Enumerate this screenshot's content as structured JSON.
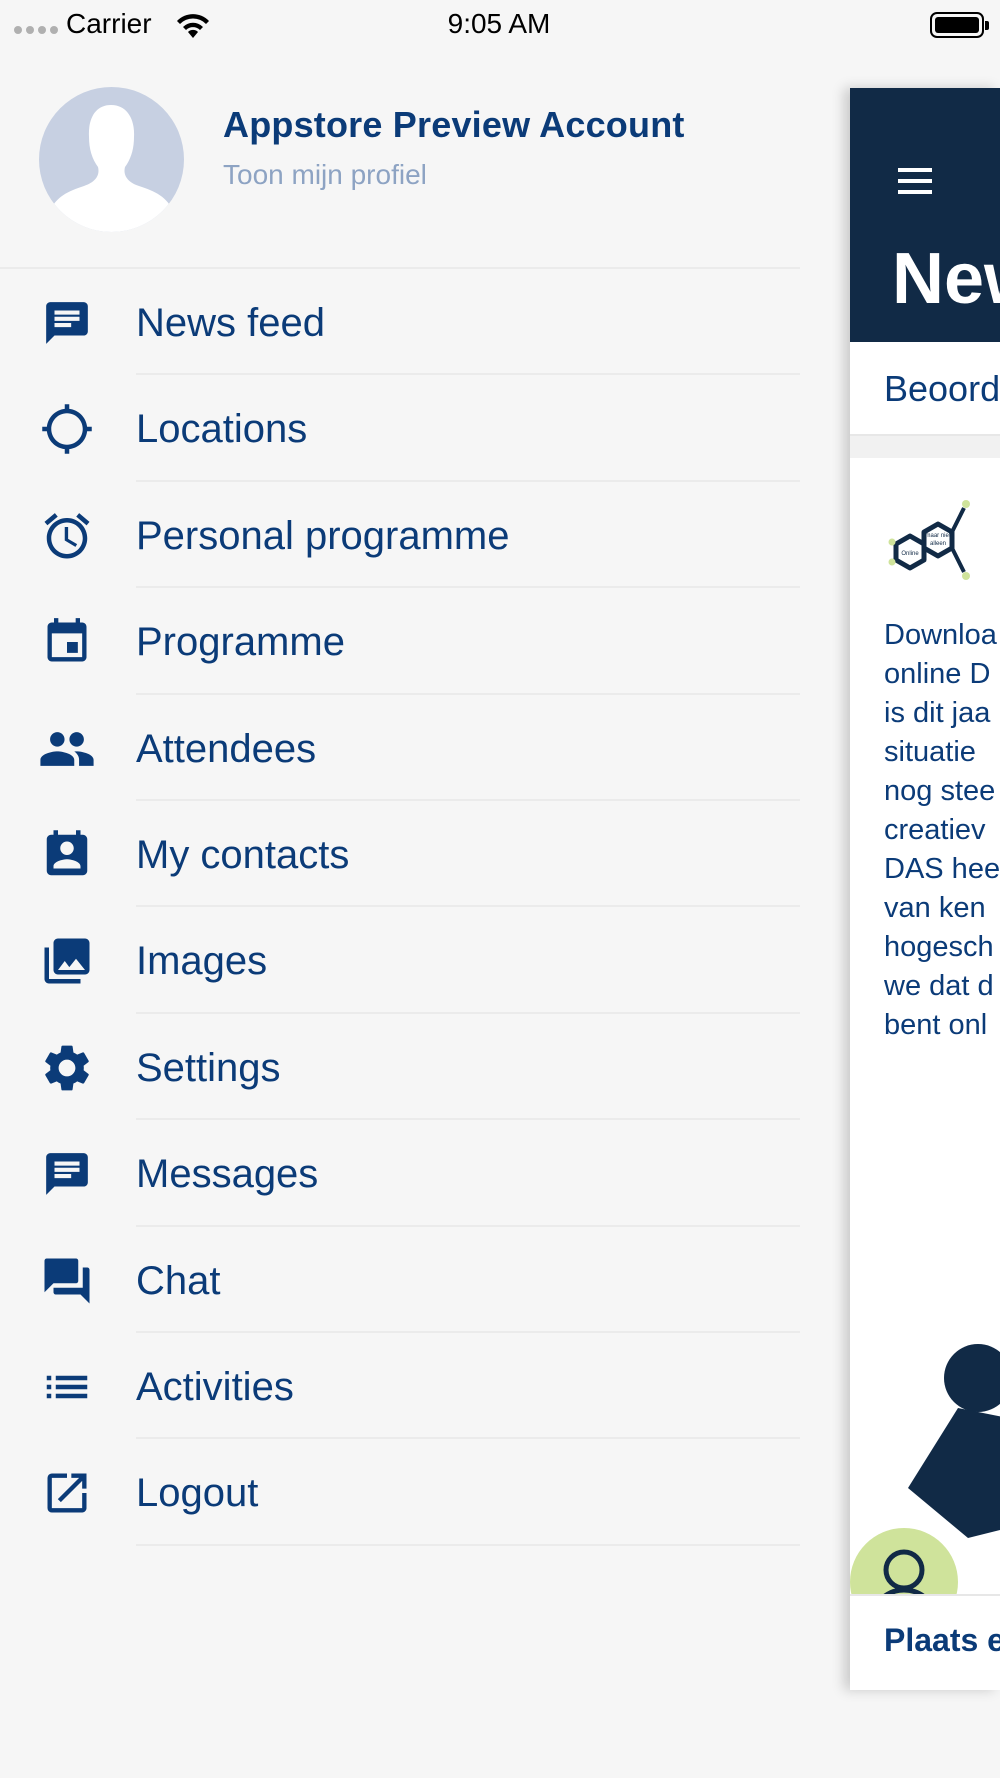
{
  "status_bar": {
    "carrier": "Carrier",
    "time": "9:05 AM"
  },
  "profile": {
    "name": "Appstore Preview Account",
    "link": "Toon mijn profiel"
  },
  "menu": {
    "items": [
      {
        "label": "News feed",
        "icon": "news-feed-icon"
      },
      {
        "label": "Locations",
        "icon": "location-crosshair-icon"
      },
      {
        "label": "Personal programme",
        "icon": "alarm-clock-icon"
      },
      {
        "label": "Programme",
        "icon": "calendar-icon"
      },
      {
        "label": "Attendees",
        "icon": "people-icon"
      },
      {
        "label": "My contacts",
        "icon": "contact-card-icon"
      },
      {
        "label": "Images",
        "icon": "images-icon"
      },
      {
        "label": "Settings",
        "icon": "gear-icon"
      },
      {
        "label": "Messages",
        "icon": "message-icon"
      },
      {
        "label": "Chat",
        "icon": "chat-icon"
      },
      {
        "label": "Activities",
        "icon": "list-icon"
      },
      {
        "label": "Logout",
        "icon": "logout-icon"
      }
    ]
  },
  "panel": {
    "title": "New",
    "tab": "Beoord",
    "logo_text_top": "maar niet",
    "logo_text_mid": "alleen",
    "logo_text_left": "Online",
    "text_lines": [
      "Downloa",
      "online D",
      "is dit jaa",
      "situatie",
      "nog stee",
      "creatiev",
      "DAS hee",
      "van ken",
      "hogesch",
      "we dat d",
      "bent onl"
    ],
    "bottom_text": "Plaats e"
  },
  "colors": {
    "primary": "#0b3b78",
    "header_bg": "#112a46",
    "muted": "#8da3c3",
    "accent_green": "#cfe39b"
  }
}
